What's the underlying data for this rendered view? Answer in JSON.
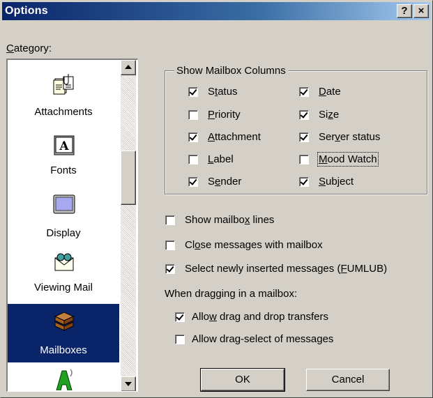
{
  "window": {
    "title": "Options",
    "help_btn": "?",
    "close_btn": "×"
  },
  "category": {
    "label_prefix": "",
    "label_u": "C",
    "label_rest": "ategory:"
  },
  "categories": [
    {
      "label": "Attachments"
    },
    {
      "label": "Fonts"
    },
    {
      "label": "Display"
    },
    {
      "label": "Viewing Mail"
    },
    {
      "label": "Mailboxes",
      "selected": true
    }
  ],
  "columns_group": {
    "title": "Show Mailbox Columns",
    "items": [
      {
        "pre": "S",
        "u": "t",
        "post": "atus",
        "checked": true
      },
      {
        "pre": "",
        "u": "D",
        "post": "ate",
        "checked": true
      },
      {
        "pre": "",
        "u": "P",
        "post": "riority",
        "checked": false
      },
      {
        "pre": "Si",
        "u": "z",
        "post": "e",
        "checked": true
      },
      {
        "pre": "",
        "u": "A",
        "post": "ttachment",
        "checked": true
      },
      {
        "pre": "Ser",
        "u": "v",
        "post": "er status",
        "checked": true
      },
      {
        "pre": "",
        "u": "L",
        "post": "abel",
        "checked": false
      },
      {
        "pre": "",
        "u": "M",
        "post": "ood Watch",
        "checked": false
      },
      {
        "pre": "S",
        "u": "e",
        "post": "nder",
        "checked": true
      },
      {
        "pre": "",
        "u": "S",
        "post": "ubject",
        "checked": true
      }
    ]
  },
  "options": {
    "mailbox_lines": {
      "pre": "Show mailbo",
      "u": "x",
      "post": " lines",
      "checked": false
    },
    "close_messages": {
      "pre": "Cl",
      "u": "o",
      "post": "se messages with mailbox",
      "checked": false
    },
    "select_new": {
      "pre": "Select newly inserted messages (",
      "u": "F",
      "post": "UMLUB)",
      "checked": true
    }
  },
  "dragging": {
    "heading": "When dragging in a mailbox:",
    "allow_transfers": {
      "pre": "Allo",
      "u": "w",
      "post": " drag and drop transfers",
      "checked": true
    },
    "allow_select": {
      "pre": "Allow dra",
      "u": "g",
      "post": "-select of messages",
      "checked": false
    }
  },
  "buttons": {
    "ok": "OK",
    "cancel": "Cancel"
  },
  "colors": {
    "selection": "#0a246a",
    "face": "#d4d0c8",
    "title_start": "#0a246a",
    "title_end": "#a6caf0"
  }
}
